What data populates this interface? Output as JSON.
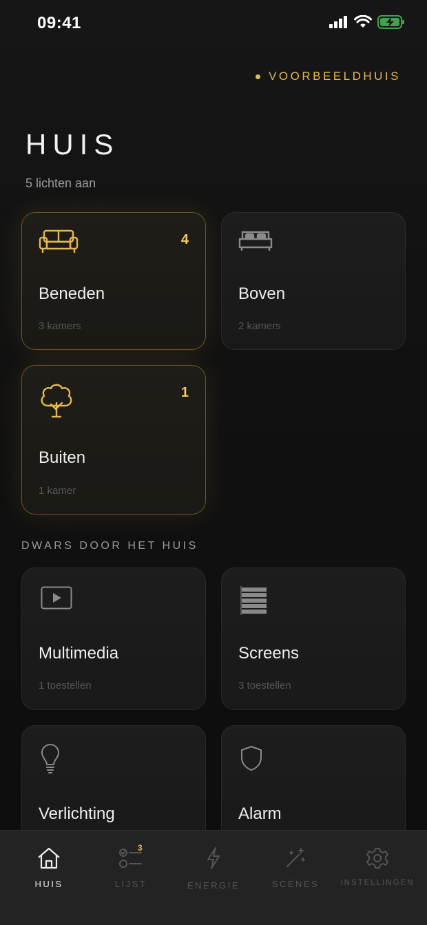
{
  "status_bar": {
    "time": "09:41"
  },
  "header": {
    "home_name": "VOORBEELDHUIS",
    "title": "HUIS",
    "subtitle": "5 lichten aan"
  },
  "floors": [
    {
      "name": "Beneden",
      "rooms": "3 kamers",
      "count": "4",
      "icon": "sofa-icon",
      "active": true
    },
    {
      "name": "Boven",
      "rooms": "2 kamers",
      "count": "",
      "icon": "bed-icon",
      "active": false
    },
    {
      "name": "Buiten",
      "rooms": "1 kamer",
      "count": "1",
      "icon": "tree-icon",
      "active": true
    }
  ],
  "section": {
    "label": "DWARS DOOR HET HUIS"
  },
  "categories": [
    {
      "name": "Multimedia",
      "meta": "1 toestellen",
      "icon": "play-icon"
    },
    {
      "name": "Screens",
      "meta": "3 toestellen",
      "icon": "blinds-icon"
    },
    {
      "name": "Verlichting",
      "meta": "",
      "icon": "bulb-icon"
    },
    {
      "name": "Alarm",
      "meta": "",
      "icon": "shield-icon"
    }
  ],
  "tabs": [
    {
      "label": "HUIS",
      "icon": "home-icon",
      "active": true
    },
    {
      "label": "LIJST",
      "icon": "list-icon",
      "badge": "3"
    },
    {
      "label": "ENERGIE",
      "icon": "bolt-icon"
    },
    {
      "label": "SCÈNES",
      "icon": "magic-wand-icon"
    },
    {
      "label": "INSTELLINGEN",
      "icon": "gear-icon"
    }
  ],
  "colors": {
    "accent": "#e6b84f",
    "background": "#111111",
    "card": "#1c1c1c"
  }
}
